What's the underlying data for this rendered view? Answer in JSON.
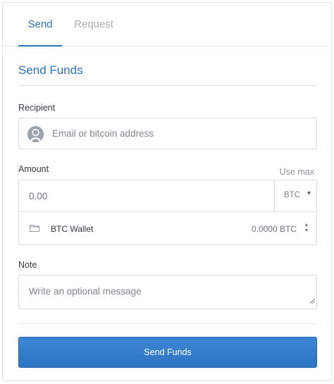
{
  "tabs": [
    {
      "label": "Send",
      "active": true
    },
    {
      "label": "Request",
      "active": false
    }
  ],
  "section_title": "Send Funds",
  "recipient": {
    "label": "Recipient",
    "placeholder": "Email or bitcoin address",
    "value": ""
  },
  "amount": {
    "label": "Amount",
    "use_max_label": "Use max",
    "placeholder": "0.00",
    "value": "",
    "currency": "BTC",
    "currency_caret": "▼"
  },
  "wallet": {
    "name": "BTC Wallet",
    "balance": "0.0000 BTC",
    "stepper_up": "▲",
    "stepper_down": "▼"
  },
  "note": {
    "label": "Note",
    "placeholder": "Write an optional message",
    "value": ""
  },
  "submit_label": "Send Funds",
  "colors": {
    "accent": "#2a72c2",
    "button": "#3580cd",
    "border": "#dadee3",
    "muted": "#a8b0b8"
  }
}
